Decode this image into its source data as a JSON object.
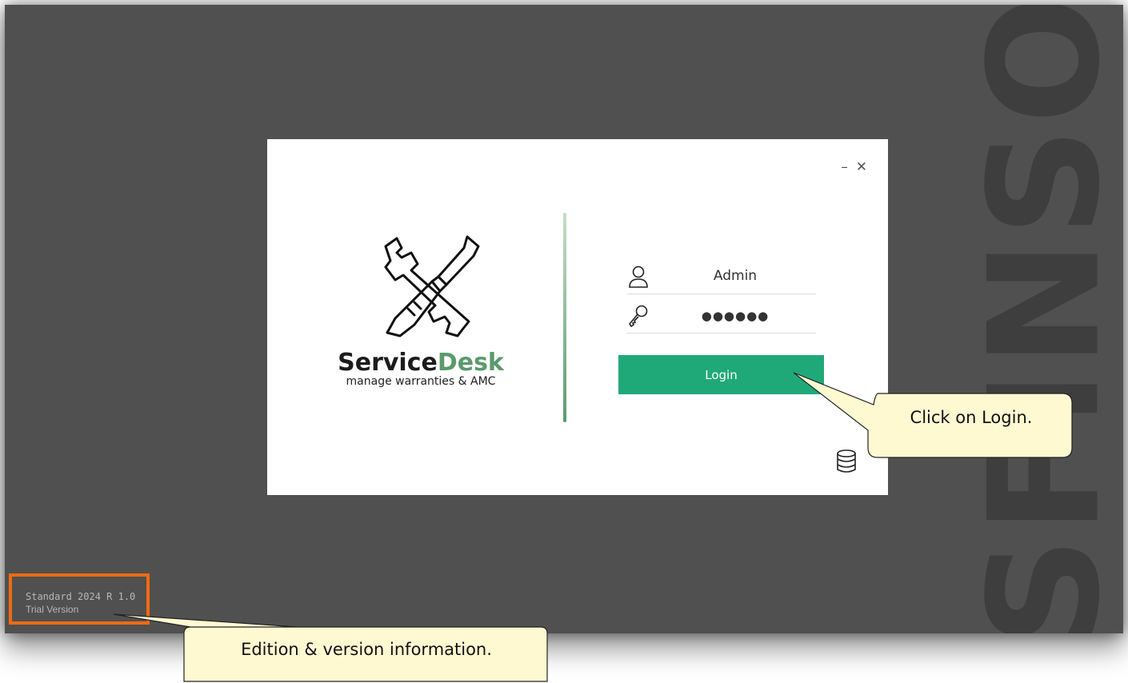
{
  "watermark": "SFINSO",
  "dialog": {
    "window_controls": {
      "minimize": "–",
      "close": "✕"
    },
    "brand": {
      "name_primary": "Service",
      "name_accent": "Desk",
      "tagline": "manage warranties & AMC"
    },
    "username": {
      "icon": "user-icon",
      "value": "Admin"
    },
    "password": {
      "icon": "key-icon",
      "value": "●●●●●●"
    },
    "login_label": "Login",
    "database_icon": "database-icon"
  },
  "version": {
    "edition": "Standard 2024 R 1.0",
    "license": "Trial Version"
  },
  "callouts": {
    "login": "Click on Login.",
    "edition": "Edition & version information."
  },
  "colors": {
    "background": "#505050",
    "login_button": "#1fa979",
    "brand_accent": "#5b9a6c",
    "highlight": "#f06a10",
    "callout_fill": "#fff9d2"
  }
}
